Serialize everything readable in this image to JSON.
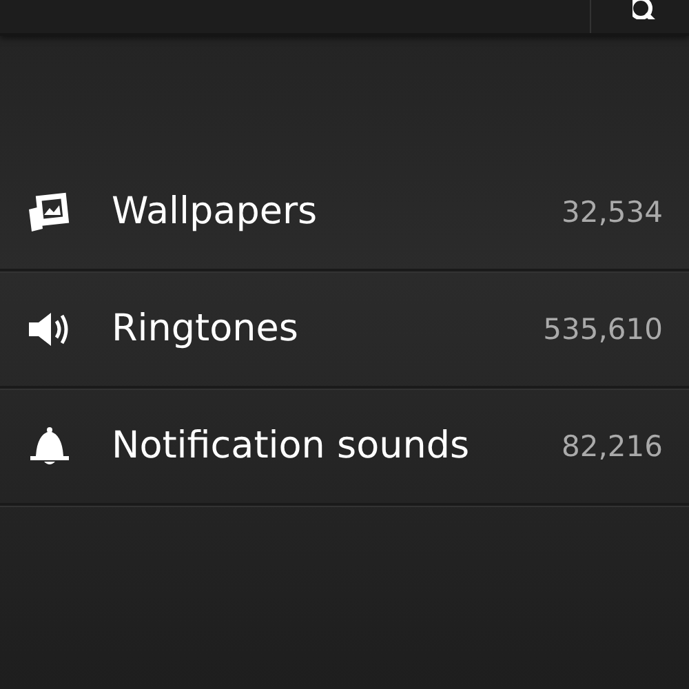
{
  "categories": [
    {
      "kind": "pictures",
      "label": "Wallpapers",
      "count": "32,534"
    },
    {
      "kind": "speaker",
      "label": "Ringtones",
      "count": "535,610"
    },
    {
      "kind": "bell",
      "label": "Notification sounds",
      "count": "82,216"
    }
  ]
}
